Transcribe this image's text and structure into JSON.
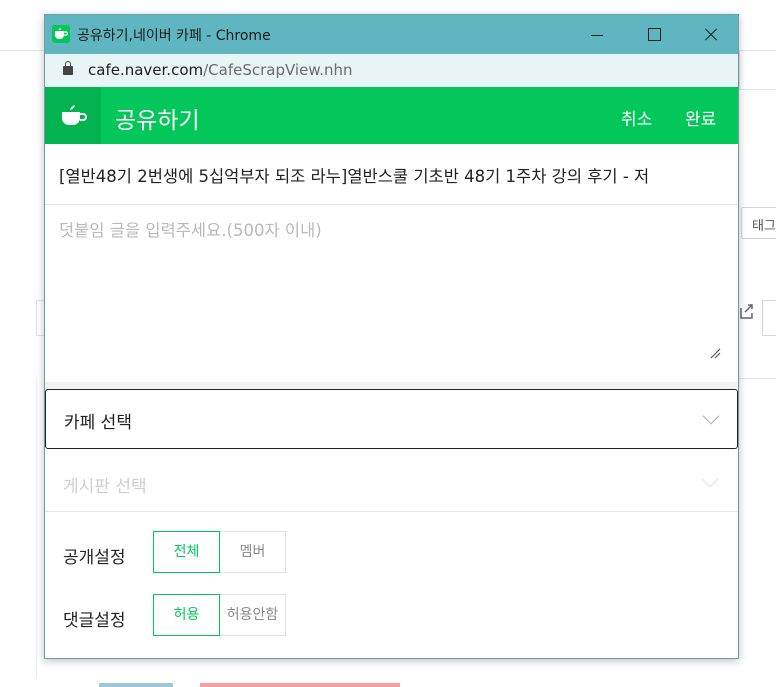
{
  "window": {
    "title": "공유하기,네이버 카페 - Chrome",
    "url_host": "cafe.naver.com",
    "url_path": "/CafeScrapView.nhn"
  },
  "header": {
    "title": "공유하기",
    "cancel_label": "취소",
    "done_label": "완료"
  },
  "post": {
    "subject": "[열반48기 2번생에 5십억부자 되조 라누]열반스쿨 기초반 48기 1주차 강의 후기 - 저"
  },
  "comment": {
    "placeholder": "덧붙임 글을 입력주세요.(500자 이내)",
    "value": ""
  },
  "cafe_select": {
    "label": "카페 선택"
  },
  "board_select": {
    "label": "게시판 선택"
  },
  "open_setting": {
    "label": "공개설정",
    "options": [
      "전체",
      "멤버"
    ],
    "selected": "전체"
  },
  "comment_setting": {
    "label": "댓글설정",
    "options": [
      "허용",
      "허용안함"
    ],
    "selected": "허용"
  },
  "background": {
    "tag_label": "태그"
  },
  "colors": {
    "naver_green": "#03c75a",
    "titlebar": "#5fb6c1",
    "addressbar": "#e8f4f6"
  }
}
